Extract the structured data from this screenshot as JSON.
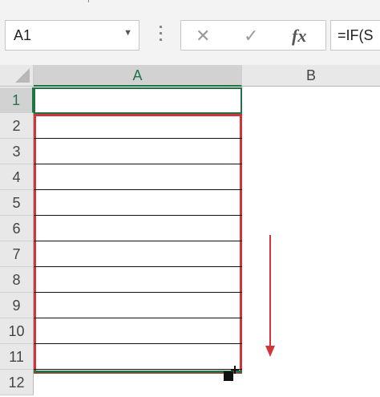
{
  "namebox": {
    "value": "A1"
  },
  "formula": {
    "cancel_icon": "✕",
    "enter_icon": "✓",
    "fx_label": "fx",
    "value": "=IF(S"
  },
  "columns": [
    "A",
    "B"
  ],
  "rows": [
    "1",
    "2",
    "3",
    "4",
    "5",
    "6",
    "7",
    "8",
    "9",
    "10",
    "11",
    "12"
  ],
  "colors": {
    "selection_green": "#217346",
    "annotation_red": "#d3343a"
  }
}
